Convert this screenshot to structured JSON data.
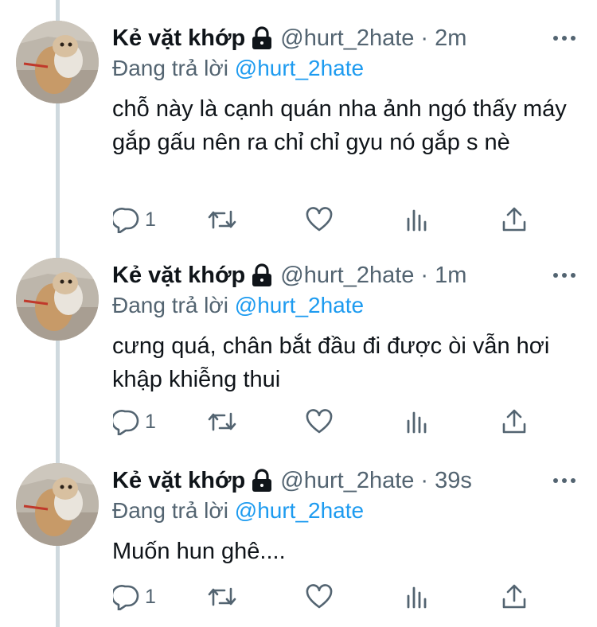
{
  "tweets": [
    {
      "name": "Kẻ vặt khớp",
      "handle": "@hurt_2hate",
      "separator": "·",
      "time": "2m",
      "replying_prefix": "Đang trả lời",
      "replying_handle": "@hurt_2hate",
      "text": "chỗ này là cạnh quán nha ảnh ngó thấy máy gắp gấu nên ra chỉ chỉ gyu nó gắp s nè",
      "reply_count": "1"
    },
    {
      "name": "Kẻ vặt khớp",
      "handle": "@hurt_2hate",
      "separator": "·",
      "time": "1m",
      "replying_prefix": "Đang trả lời",
      "replying_handle": "@hurt_2hate",
      "text": "cưng quá, chân bắt đầu đi được òi vẫn hơi khập khiễng thui",
      "reply_count": "1"
    },
    {
      "name": "Kẻ vặt khớp",
      "handle": "@hurt_2hate",
      "separator": "·",
      "time": "39s",
      "replying_prefix": "Đang trả lời",
      "replying_handle": "@hurt_2hate",
      "text": "Muốn hun ghê....",
      "reply_count": "1"
    }
  ],
  "icons": {
    "lock": "lock-icon",
    "more": "more-horizontal-icon",
    "reply": "reply-bubble-icon",
    "retweet": "retweet-icon",
    "like": "heart-icon",
    "analytics": "analytics-bars-icon",
    "share": "share-arrow-icon"
  },
  "colors": {
    "text": "#0f1419",
    "secondary": "#536471",
    "accent": "#1d9bf0",
    "thread_line": "#cfd9de"
  }
}
